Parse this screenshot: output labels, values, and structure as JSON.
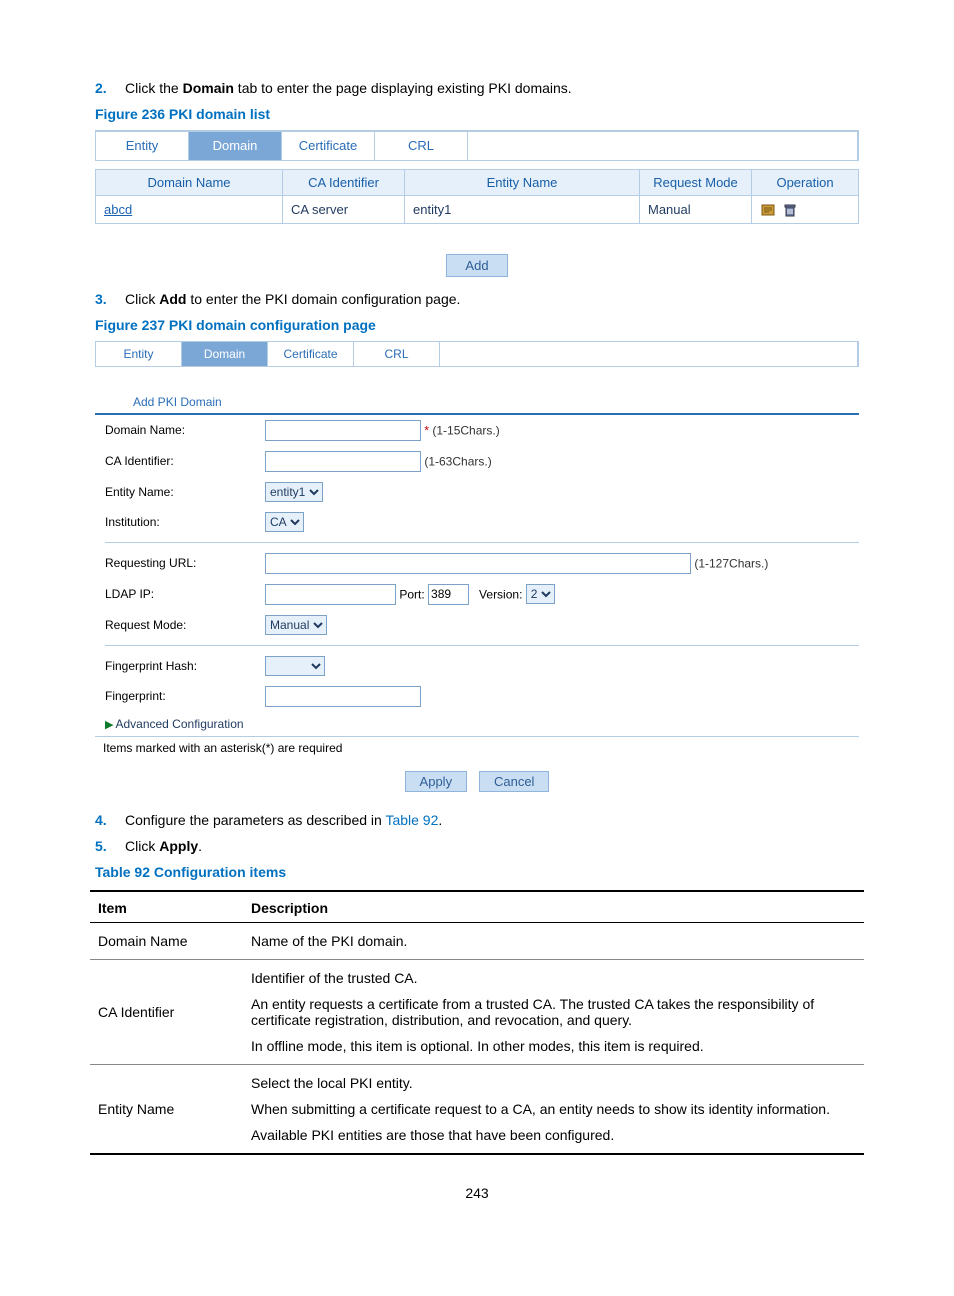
{
  "steps": {
    "s2_num": "2.",
    "s2_pre": "Click the ",
    "s2_bold": "Domain",
    "s2_post": " tab to enter the page displaying existing PKI domains.",
    "s3_num": "3.",
    "s3_pre": "Click ",
    "s3_bold": "Add",
    "s3_post": " to enter the PKI domain configuration page.",
    "s4_num": "4.",
    "s4_pre": "Configure the parameters as described in ",
    "s4_link": "Table 92",
    "s4_post": ".",
    "s5_num": "5.",
    "s5_pre": "Click ",
    "s5_bold": "Apply",
    "s5_post": "."
  },
  "fig236": {
    "caption": "Figure 236 PKI domain list",
    "tabs": [
      "Entity",
      "Domain",
      "Certificate",
      "CRL"
    ],
    "headers": [
      "Domain Name",
      "CA Identifier",
      "Entity Name",
      "Request Mode",
      "Operation"
    ],
    "row": {
      "domain": "abcd",
      "ca": "CA server",
      "entity": "entity1",
      "mode": "Manual"
    },
    "add_label": "Add"
  },
  "fig237": {
    "caption": "Figure 237 PKI domain configuration page",
    "tabs": [
      "Entity",
      "Domain",
      "Certificate",
      "CRL"
    ],
    "section": "Add PKI Domain",
    "fields": {
      "domain_name": "Domain Name:",
      "domain_name_hint": "(1-15Chars.)",
      "ca_id": "CA Identifier:",
      "ca_id_hint": "(1-63Chars.)",
      "entity_name": "Entity Name:",
      "entity_name_val": "entity1",
      "institution": "Institution:",
      "institution_val": "CA",
      "req_url": "Requesting URL:",
      "req_url_hint": "(1-127Chars.)",
      "ldap": "LDAP IP:",
      "port_lbl": "Port:",
      "port_val": "389",
      "version_lbl": "Version:",
      "version_val": "2",
      "req_mode": "Request Mode:",
      "req_mode_val": "Manual",
      "fp_hash": "Fingerprint Hash:",
      "fp": "Fingerprint:",
      "adv": "Advanced Configuration"
    },
    "footer_note": "Items marked with an asterisk(*) are required",
    "apply": "Apply",
    "cancel": "Cancel"
  },
  "table92": {
    "caption": "Table 92 Configuration items",
    "head_item": "Item",
    "head_desc": "Description",
    "rows": [
      {
        "item": "Domain Name",
        "desc": [
          "Name of the PKI domain."
        ]
      },
      {
        "item": "CA Identifier",
        "desc": [
          "Identifier of the trusted CA.",
          "An entity requests a certificate from a trusted CA. The trusted CA takes the responsibility of certificate registration, distribution, and revocation, and query.",
          "In offline mode, this item is optional. In other modes, this item is required."
        ]
      },
      {
        "item": "Entity Name",
        "desc": [
          "Select the local PKI entity.",
          "When submitting a certificate request to a CA, an entity needs to show its identity information.",
          "Available PKI entities are those that have been configured."
        ]
      }
    ]
  },
  "page_number": "243"
}
